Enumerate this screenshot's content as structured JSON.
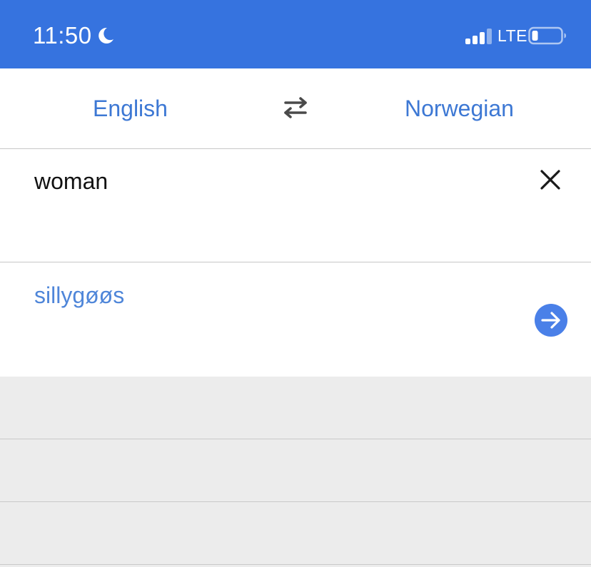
{
  "status_bar": {
    "time": "11:50",
    "network": "LTE",
    "icons": [
      "moon-icon",
      "signal-icon",
      "battery-icon"
    ],
    "background": "#3673df"
  },
  "languages": {
    "source": "English",
    "target": "Norwegian",
    "swap_icon": "swap-arrows-icon",
    "accent_color": "#3d78d4"
  },
  "input": {
    "value": "woman",
    "clear_icon": "close-icon"
  },
  "result": {
    "text": "sillygøøs",
    "go_icon": "arrow-right-icon",
    "button_color": "#4a80e8"
  },
  "history": {
    "rows": [
      {},
      {},
      {}
    ]
  }
}
